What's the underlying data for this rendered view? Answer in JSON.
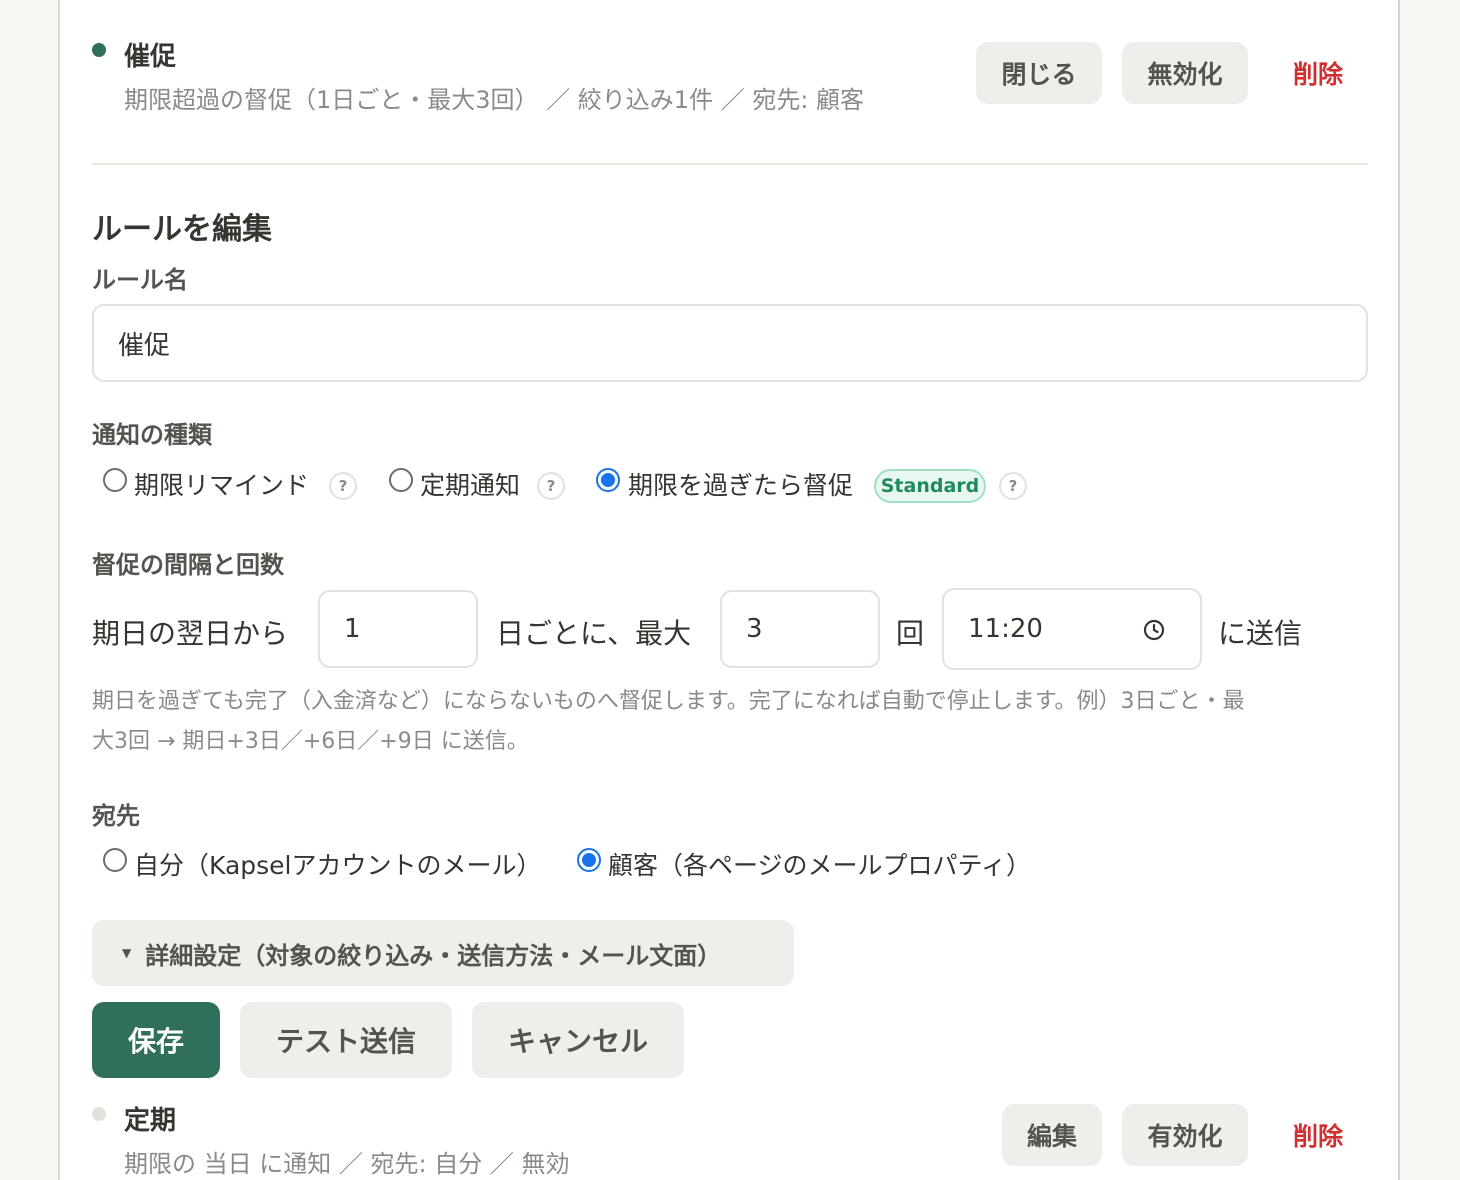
{
  "rule1": {
    "title": "催促",
    "summary": "期限超過の督促（1日ごと・最大3回） ／ 絞り込み1件 ／ 宛先: 顧客",
    "status_color": "#2f6f5b",
    "actions": {
      "close": "閉じる",
      "disable": "無効化",
      "delete": "削除"
    }
  },
  "editor": {
    "heading": "ルールを編集",
    "name_label": "ルール名",
    "name_value": "催促",
    "type_label": "通知の種類",
    "types": [
      {
        "label": "期限リマインド",
        "help": "?",
        "checked": false
      },
      {
        "label": "定期通知",
        "help": "?",
        "checked": false
      },
      {
        "label": "期限を過ぎたら督促",
        "badge": "Standard",
        "help": "?",
        "checked": true
      }
    ],
    "interval_label": "督促の間隔と回数",
    "interval": {
      "prefix": "期日の翌日から",
      "days": "1",
      "mid": "日ごとに、最大",
      "count": "3",
      "count_suffix": "回",
      "time": "11:20",
      "suffix": "に送信"
    },
    "hint_line1": "期日を過ぎても完了（入金済など）にならないものへ督促します。完了になれば自動で停止します。例）3日ごと・最",
    "hint_line2": "大3回 → 期日+3日／+6日／+9日 に送信。",
    "recipient_label": "宛先",
    "recipients": [
      {
        "label": "自分（Kapselアカウントのメール）",
        "checked": false
      },
      {
        "label": "顧客（各ページのメールプロパティ）",
        "checked": true
      }
    ],
    "advanced": "詳細設定（対象の絞り込み・送信方法・メール文面）",
    "buttons": {
      "save": "保存",
      "test": "テスト送信",
      "cancel": "キャンセル"
    }
  },
  "rule2": {
    "title": "定期",
    "summary": "期限の 当日 に通知 ／ 宛先: 自分 ／ 無効",
    "status_color": "#e3e1dc",
    "actions": {
      "edit": "編集",
      "enable": "有効化",
      "delete": "削除"
    }
  },
  "colors": {
    "primary": "#2f6f5b",
    "danger": "#d0302f",
    "radio": "#1a73e8"
  }
}
